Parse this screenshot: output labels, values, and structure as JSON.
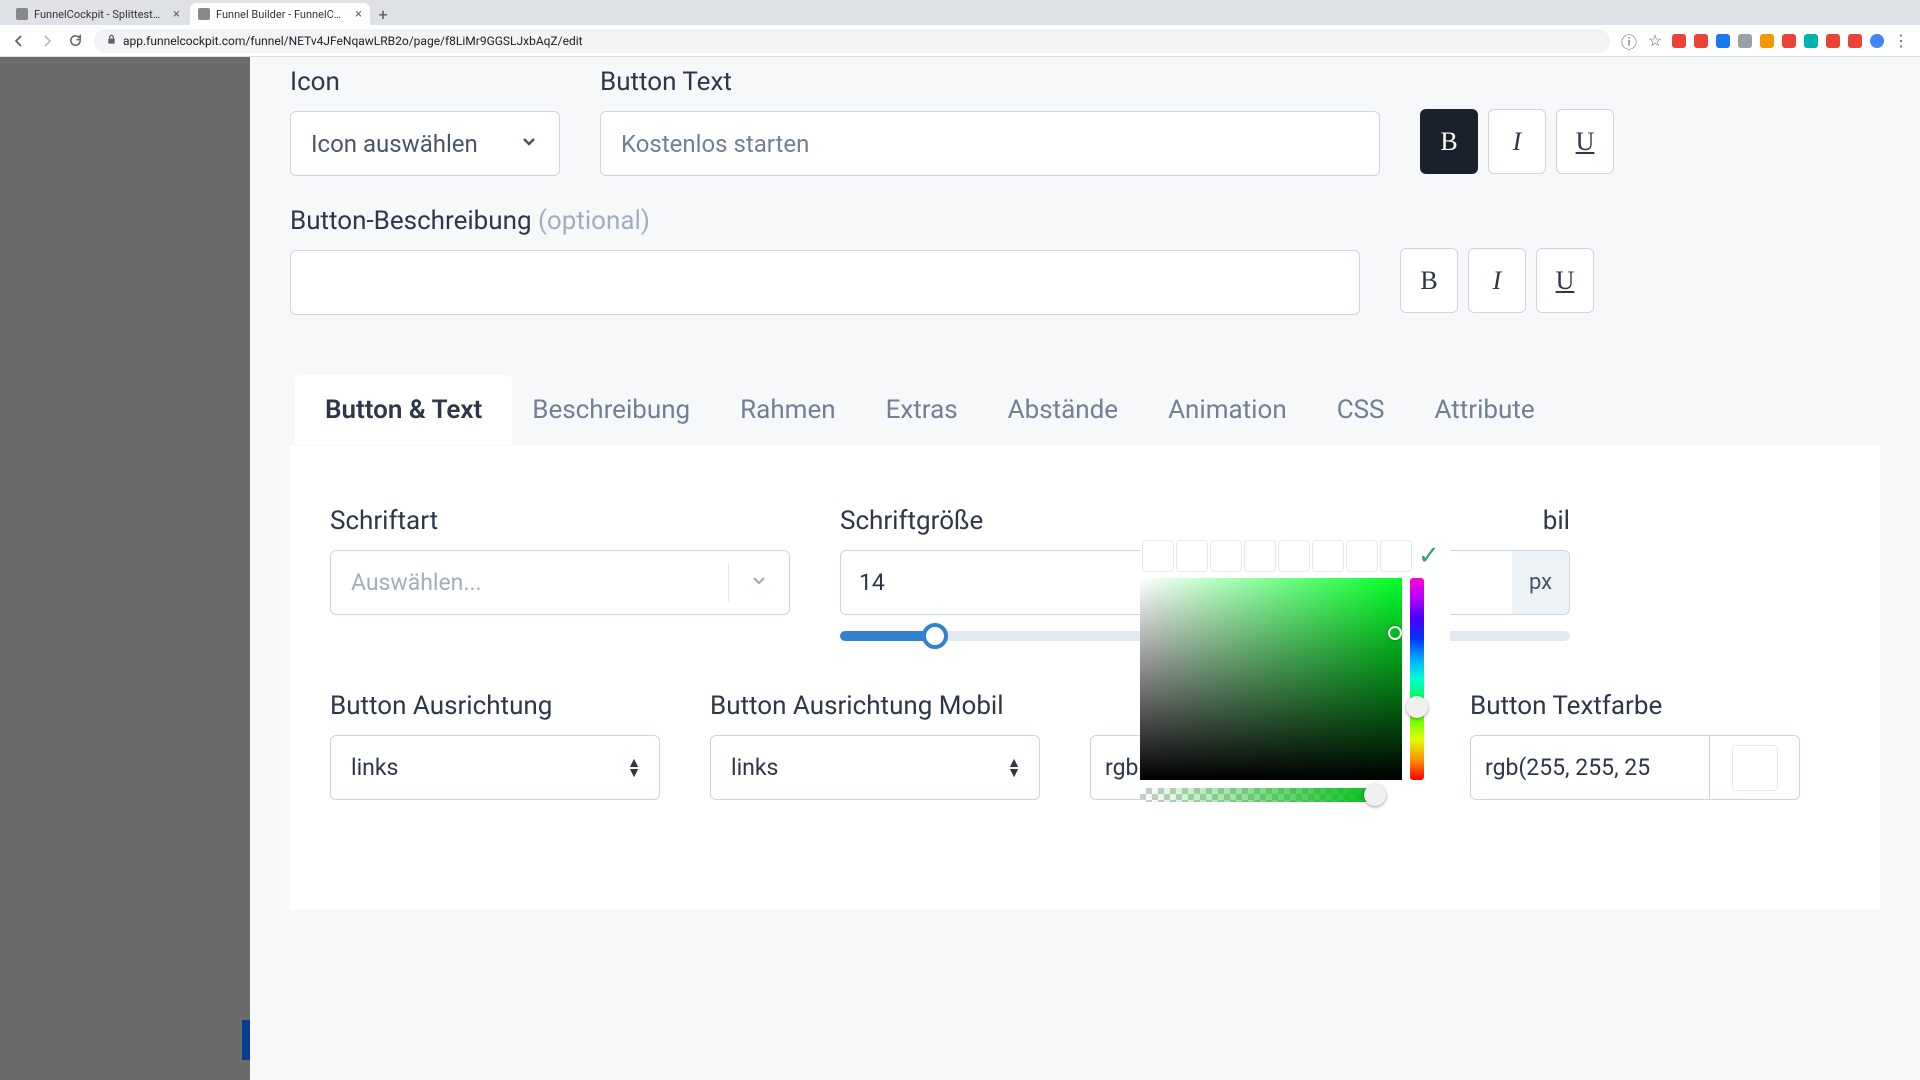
{
  "browser": {
    "tabs": [
      {
        "title": "FunnelCockpit - Splittests, M..."
      },
      {
        "title": "Funnel Builder - FunnelCockpit"
      }
    ],
    "url": "app.funnelcockpit.com/funnel/NETv4JFeNqawLRB2o/page/f8LiMr9GGSLJxbAqZ/edit"
  },
  "section_icon": {
    "label": "Icon",
    "select_text": "Icon auswählen"
  },
  "section_button_text": {
    "label": "Button Text",
    "value": "Kostenlos starten"
  },
  "section_desc": {
    "label": "Button-Beschreibung",
    "optional": "(optional)",
    "value": ""
  },
  "tabs": {
    "items": [
      "Button & Text",
      "Beschreibung",
      "Rahmen",
      "Extras",
      "Abstände",
      "Animation",
      "CSS",
      "Attribute"
    ]
  },
  "font": {
    "label_font": "Schriftart",
    "placeholder": "Auswählen...",
    "label_size": "Schriftgröße",
    "size_value": "14",
    "label_size_mobile_suffix": "bil",
    "px": "px"
  },
  "align": {
    "desktop_label": "Button Ausrichtung",
    "desktop_value": "links",
    "mobile_label": "Button Ausrichtung Mobil",
    "mobile_value": "links"
  },
  "color": {
    "value": "rgb(4, 190, 23)",
    "hex": "#04be17"
  },
  "text_color": {
    "label": "Button Textfarbe",
    "value": "rgb(255, 255, 25",
    "swatch": "#ffffff"
  }
}
